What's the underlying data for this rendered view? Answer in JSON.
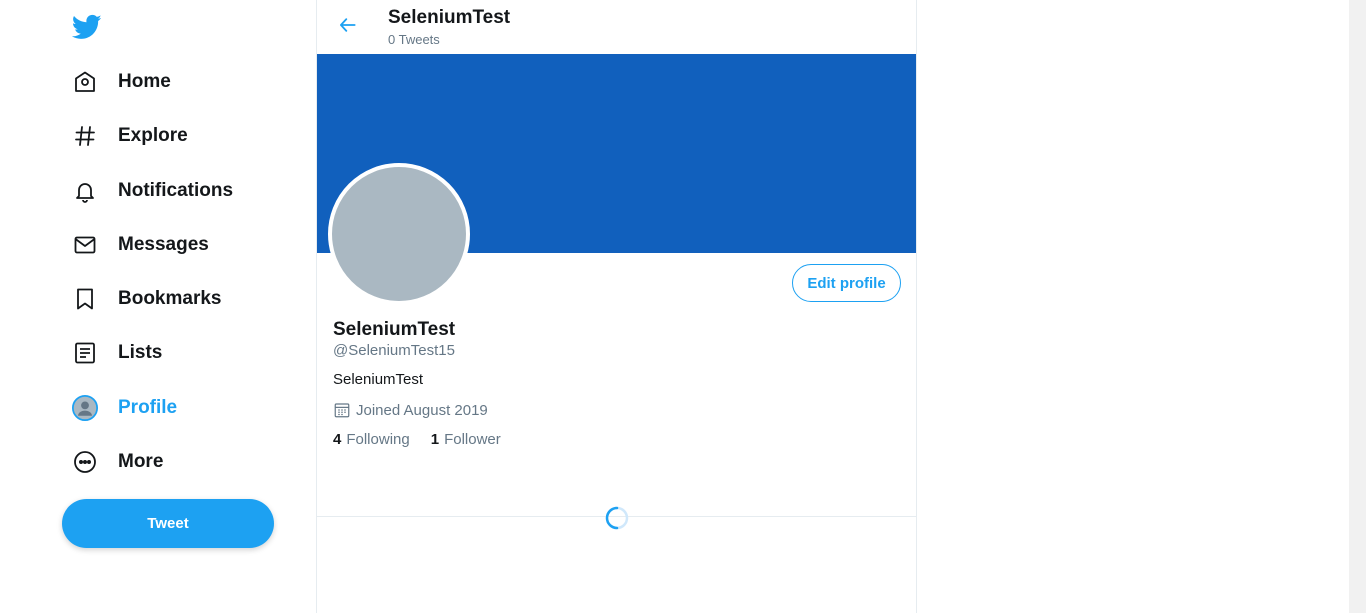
{
  "sidebar": {
    "logo_icon": "twitter-bird-icon",
    "items": [
      {
        "label": "Home",
        "icon": "home-icon"
      },
      {
        "label": "Explore",
        "icon": "hashtag-icon"
      },
      {
        "label": "Notifications",
        "icon": "bell-icon"
      },
      {
        "label": "Messages",
        "icon": "envelope-icon"
      },
      {
        "label": "Bookmarks",
        "icon": "bookmark-icon"
      },
      {
        "label": "Lists",
        "icon": "list-icon"
      },
      {
        "label": "Profile",
        "icon": "profile-avatar-icon",
        "active": true
      },
      {
        "label": "More",
        "icon": "more-icon"
      }
    ],
    "tweet_button": "Tweet"
  },
  "header": {
    "back_icon": "arrow-left-icon",
    "title": "SeleniumTest",
    "subtitle": "0 Tweets"
  },
  "profile": {
    "edit_button": "Edit profile",
    "name": "SeleniumTest",
    "handle": "@SeleniumTest15",
    "bio": "SeleniumTest",
    "joined": "Joined August 2019",
    "following_count": "4",
    "following_label": "Following",
    "followers_count": "1",
    "followers_label": "Follower"
  },
  "colors": {
    "accent": "#1da1f2",
    "banner": "#1160bd",
    "avatar_placeholder": "#aab8c2",
    "text_primary": "#14171a",
    "text_secondary": "#657786"
  }
}
